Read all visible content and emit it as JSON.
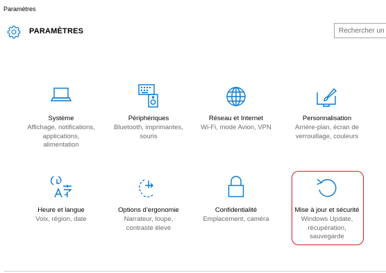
{
  "window": {
    "title": "Paramètres"
  },
  "header": {
    "title": "PARAMÈTRES",
    "icon": "gear-icon"
  },
  "search": {
    "placeholder": "Rechercher un p"
  },
  "colors": {
    "accent": "#0078d7",
    "highlight": "#e0161c",
    "desc_text": "#6b6b6b"
  },
  "tiles": [
    {
      "icon": "laptop-icon",
      "label": "Système",
      "desc1": "Affichage, notifications,",
      "desc2": "applications,",
      "desc3": "alimentation"
    },
    {
      "icon": "keyboard-speaker-icon",
      "label": "Périphériques",
      "desc1": "Bluetooth, imprimantes,",
      "desc2": "souris",
      "desc3": ""
    },
    {
      "icon": "globe-icon",
      "label": "Réseau et Internet",
      "desc1": "Wi-Fi, mode Avion, VPN",
      "desc2": "",
      "desc3": ""
    },
    {
      "icon": "paintbrush-display-icon",
      "label": "Personnalisation",
      "desc1": "Arrière-plan, écran de",
      "desc2": "verrouillage, couleurs",
      "desc3": ""
    },
    {
      "icon": "language-icon",
      "label": "Heure et langue",
      "desc1": "Voix, région, date",
      "desc2": "",
      "desc3": ""
    },
    {
      "icon": "ease-of-access-icon",
      "label": "Options d’ergonomie",
      "desc1": "Narrateur, loupe,",
      "desc2": "contraste élevé",
      "desc3": ""
    },
    {
      "icon": "lock-icon",
      "label": "Confidentialité",
      "desc1": "Emplacement, caméra",
      "desc2": "",
      "desc3": ""
    },
    {
      "icon": "update-refresh-icon",
      "label": "Mise à jour et sécurité",
      "desc1": "Windows Update,",
      "desc2": "récupération,",
      "desc3": "sauvegarde"
    }
  ]
}
